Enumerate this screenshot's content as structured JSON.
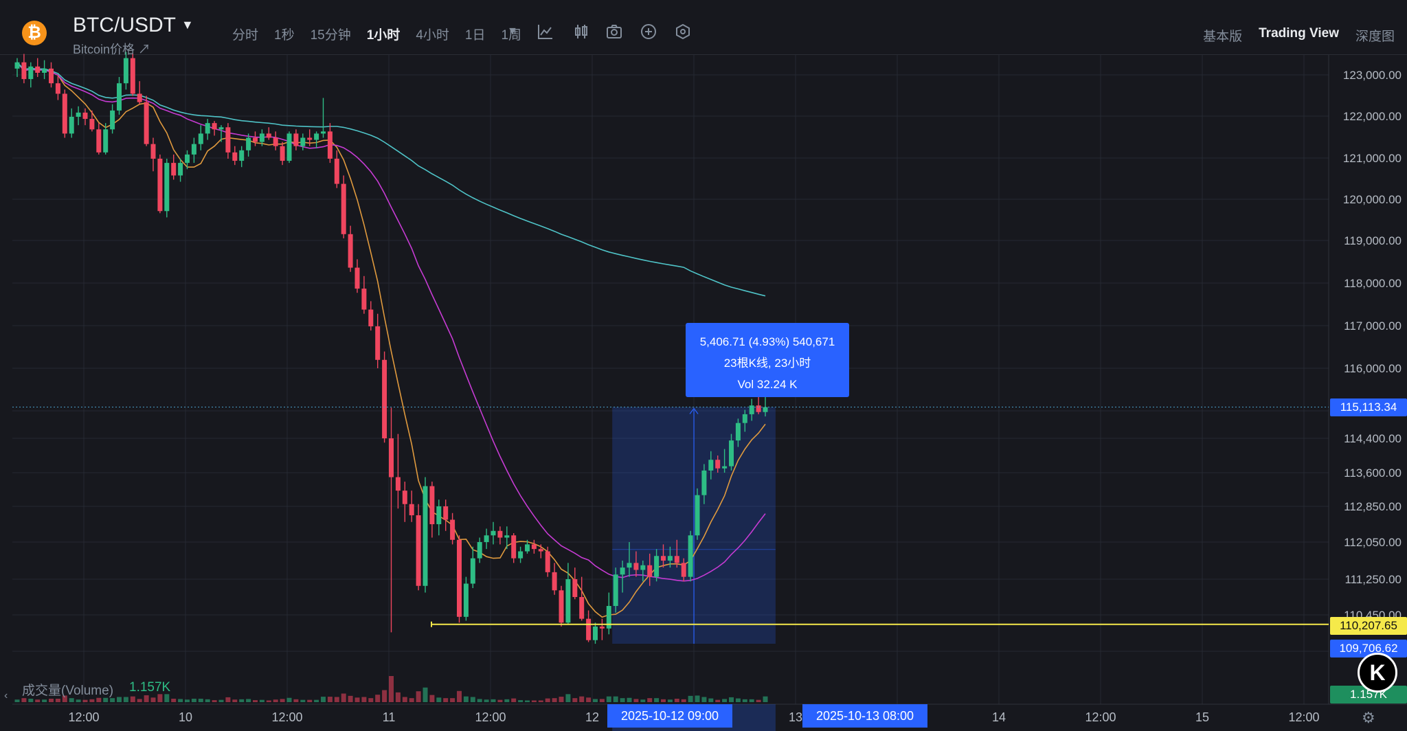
{
  "header": {
    "coin_icon": "bitcoin-icon",
    "pair": "BTC/USDT",
    "subtitle": "Bitcoin价格 ↗",
    "intervals": [
      "分时",
      "1秒",
      "15分钟",
      "1小时",
      "4小时",
      "1日",
      "1周"
    ],
    "active_interval": "1小时",
    "tools": [
      "more-intervals-chevron-icon",
      "indicator-icon",
      "candle-type-icon",
      "camera-icon",
      "add-icon",
      "settings-hex-icon"
    ],
    "views": [
      "基本版",
      "Trading View",
      "深度图"
    ],
    "active_view": "Trading View"
  },
  "price_axis": {
    "labels": [
      "123,000.00",
      "122,000.00",
      "121,000.00",
      "120,000.00",
      "119,000.00",
      "118,000.00",
      "117,000.00",
      "116,000.00",
      "114,400.00",
      "113,600.00",
      "112,850.00",
      "112,050.00",
      "111,250.00",
      "110,450.00"
    ],
    "last_price": "115,113.34",
    "horizontal_line_price": "110,207.65",
    "range_low_price": "109,706.62"
  },
  "time_axis": {
    "labels": [
      "12:00",
      "10",
      "12:00",
      "11",
      "12:00",
      "12",
      "13",
      "14",
      "12:00",
      "15",
      "12:00"
    ],
    "range_start": "2025-10-12   09:00",
    "range_end": "2025-10-13   08:00"
  },
  "measure_tooltip": {
    "line1": "5,406.71 (4.93%) 540,671",
    "line2": "23根K线, 23小时",
    "line3": "Vol 32.24 K"
  },
  "volume": {
    "label": "成交量(Volume)",
    "value": "1.157K",
    "axis_value": "1.157K"
  },
  "colors": {
    "up": "#2ebd85",
    "down": "#f0465f",
    "ma_short": "#e09a3e",
    "ma_mid": "#c63bd3",
    "ma_long": "#4fc4c8",
    "highlight": "#2962ff",
    "hline": "#f5e94a"
  },
  "chart_data": {
    "type": "candlestick",
    "interval": "1h",
    "x_start": "2025-10-09 06:00",
    "ohlc": [
      [
        123150,
        123400,
        122950,
        123300
      ],
      [
        123300,
        123500,
        122800,
        122900
      ],
      [
        122900,
        123300,
        122700,
        123200
      ],
      [
        123200,
        123400,
        122950,
        123050
      ],
      [
        123050,
        123350,
        122900,
        123150
      ],
      [
        123150,
        123300,
        122700,
        122800
      ],
      [
        122800,
        123000,
        122400,
        122550
      ],
      [
        122550,
        122650,
        121500,
        121600
      ],
      [
        121600,
        122200,
        121500,
        122000
      ],
      [
        122000,
        122250,
        121800,
        122100
      ],
      [
        122100,
        122200,
        121800,
        121950
      ],
      [
        121950,
        122150,
        121650,
        121700
      ],
      [
        121700,
        121850,
        121100,
        121150
      ],
      [
        121150,
        121850,
        121100,
        121700
      ],
      [
        121700,
        122300,
        121600,
        122150
      ],
      [
        122150,
        122950,
        122050,
        122800
      ],
      [
        122800,
        123550,
        122650,
        123400
      ],
      [
        123400,
        123500,
        122500,
        122550
      ],
      [
        122550,
        122850,
        122300,
        122350
      ],
      [
        122350,
        122500,
        121300,
        121350
      ],
      [
        121350,
        121500,
        120700,
        121000
      ],
      [
        121000,
        121100,
        119700,
        119750
      ],
      [
        119750,
        121000,
        119600,
        120900
      ],
      [
        120900,
        121100,
        120500,
        120600
      ],
      [
        120600,
        121000,
        120450,
        120900
      ],
      [
        120900,
        121200,
        120750,
        121100
      ],
      [
        121100,
        121500,
        120900,
        121350
      ],
      [
        121350,
        121800,
        121200,
        121600
      ],
      [
        121600,
        121950,
        121450,
        121850
      ],
      [
        121850,
        121900,
        121550,
        121700
      ],
      [
        121700,
        121800,
        121400,
        121750
      ],
      [
        121750,
        121850,
        121000,
        121150
      ],
      [
        121150,
        121300,
        120850,
        120950
      ],
      [
        120950,
        121300,
        120800,
        121200
      ],
      [
        121200,
        121600,
        121050,
        121500
      ],
      [
        121500,
        121650,
        121300,
        121400
      ],
      [
        121400,
        121700,
        121300,
        121600
      ],
      [
        121600,
        121750,
        121450,
        121500
      ],
      [
        121500,
        121650,
        121200,
        121300
      ],
      [
        121300,
        121400,
        120850,
        120950
      ],
      [
        120950,
        121650,
        120900,
        121600
      ],
      [
        121600,
        121700,
        121200,
        121300
      ],
      [
        121300,
        121600,
        121200,
        121500
      ],
      [
        121500,
        121700,
        121300,
        121450
      ],
      [
        121450,
        121650,
        121250,
        121600
      ],
      [
        121600,
        122450,
        121500,
        121650
      ],
      [
        121650,
        121850,
        120900,
        121000
      ],
      [
        121000,
        121200,
        120300,
        120400
      ],
      [
        120400,
        120600,
        119100,
        119200
      ],
      [
        119200,
        119400,
        118300,
        118400
      ],
      [
        118400,
        118600,
        117800,
        117900
      ],
      [
        117900,
        118200,
        117300,
        117400
      ],
      [
        117400,
        117600,
        116900,
        117000
      ],
      [
        117000,
        117300,
        116000,
        116200
      ],
      [
        116200,
        116400,
        114300,
        114400
      ],
      [
        114400,
        115100,
        110000,
        113500
      ],
      [
        113500,
        114500,
        112800,
        113200
      ],
      [
        113200,
        113400,
        112500,
        112900
      ],
      [
        112900,
        113200,
        112500,
        112650
      ],
      [
        112650,
        112900,
        111000,
        111100
      ],
      [
        111100,
        113500,
        110950,
        113300
      ],
      [
        113300,
        113400,
        112150,
        112450
      ],
      [
        112450,
        113000,
        112200,
        112850
      ],
      [
        112850,
        113000,
        112300,
        112550
      ],
      [
        112550,
        112700,
        112000,
        112100
      ],
      [
        112100,
        112200,
        110250,
        110400
      ],
      [
        110400,
        111300,
        110300,
        111150
      ],
      [
        111150,
        111950,
        111050,
        111700
      ],
      [
        111700,
        112150,
        111600,
        112050
      ],
      [
        112050,
        112350,
        111900,
        112200
      ],
      [
        112200,
        112500,
        112000,
        112300
      ],
      [
        112300,
        112400,
        112000,
        112150
      ],
      [
        112150,
        112400,
        111900,
        112200
      ],
      [
        112200,
        112250,
        111600,
        111700
      ],
      [
        111700,
        111950,
        111600,
        111850
      ],
      [
        111850,
        112100,
        111800,
        112000
      ],
      [
        112000,
        112100,
        111800,
        111900
      ],
      [
        111900,
        112000,
        111700,
        111850
      ],
      [
        111850,
        111950,
        111300,
        111400
      ],
      [
        111400,
        111600,
        110900,
        111000
      ],
      [
        111000,
        111100,
        110150,
        110250
      ],
      [
        110250,
        111600,
        110200,
        111250
      ],
      [
        111250,
        111500,
        110800,
        110850
      ],
      [
        110850,
        111300,
        110300,
        110350
      ],
      [
        110350,
        110550,
        109750,
        109800
      ],
      [
        109800,
        110250,
        109706,
        110150
      ],
      [
        110150,
        110350,
        109800,
        110100
      ],
      [
        110100,
        110950,
        109950,
        110650
      ],
      [
        110650,
        111500,
        110500,
        111350
      ],
      [
        111350,
        111650,
        110950,
        111500
      ],
      [
        111500,
        112050,
        111300,
        111600
      ],
      [
        111600,
        111850,
        111300,
        111450
      ],
      [
        111450,
        111650,
        111200,
        111550
      ],
      [
        111550,
        111800,
        111100,
        111300
      ],
      [
        111300,
        111900,
        111200,
        111750
      ],
      [
        111750,
        112000,
        111500,
        111650
      ],
      [
        111650,
        111950,
        111500,
        111750
      ],
      [
        111750,
        112100,
        111500,
        111600
      ],
      [
        111600,
        111700,
        111200,
        111300
      ],
      [
        111300,
        112300,
        111200,
        112200
      ],
      [
        112200,
        113250,
        112100,
        113100
      ],
      [
        113100,
        113800,
        112900,
        113650
      ],
      [
        113650,
        114100,
        113450,
        113900
      ],
      [
        113900,
        114000,
        113600,
        113700
      ],
      [
        113700,
        114150,
        113600,
        113750
      ],
      [
        113750,
        114500,
        113650,
        114350
      ],
      [
        114350,
        114850,
        114200,
        114750
      ],
      [
        114750,
        115050,
        114550,
        114950
      ],
      [
        114950,
        115300,
        114800,
        115150
      ],
      [
        115150,
        115350,
        114950,
        115000
      ],
      [
        115000,
        115900,
        114900,
        115113
      ]
    ],
    "ylim": [
      109300,
      123400
    ],
    "x_labels": [
      "12:00",
      "10",
      "12:00",
      "11",
      "12:00",
      "12",
      "13",
      "14",
      "12:00",
      "15",
      "12:00"
    ],
    "hline": 110207.65,
    "last_price": 115113.34,
    "measure_range": {
      "start_index": 88,
      "end_index": 111,
      "low": 109706.62,
      "high": 115113.34
    }
  }
}
